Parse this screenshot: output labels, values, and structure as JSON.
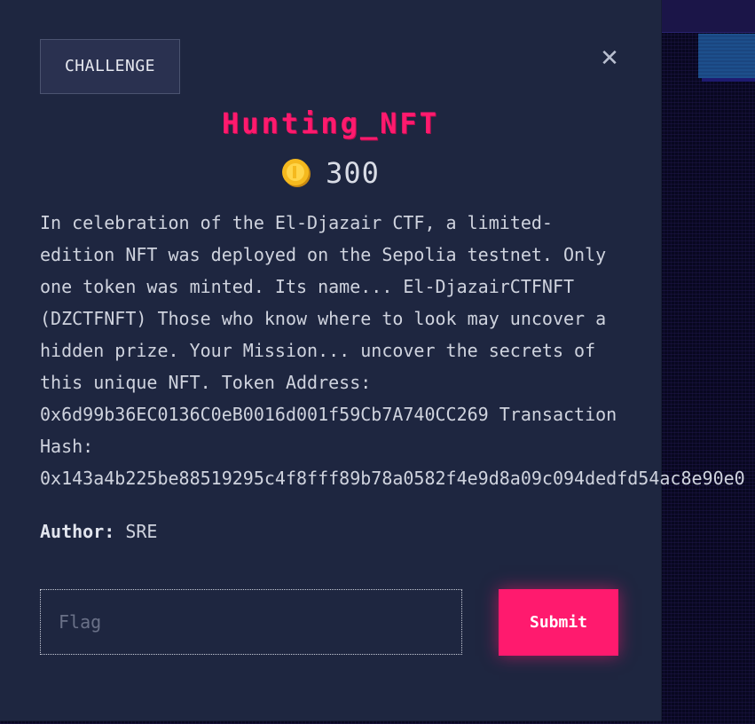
{
  "modal": {
    "badge_label": "CHALLENGE",
    "close_icon": "close-icon",
    "title": "Hunting_NFT",
    "points": "300",
    "coin_icon": "coin-icon",
    "description": "In celebration of the El-Djazair CTF, a limited-\nedition NFT was deployed on the Sepolia testnet. Only\none token was minted. Its name... El-DjazairCTFNFT\n(DZCTFNFT) Those who know where to look may uncover a\nhidden prize. Your Mission... uncover the secrets of\nthis unique NFT. Token Address:\n0x6d99b36EC0136C0eB0016d001f59Cb7A740CC269 Transaction\nHash:\n0x143a4b225be88519295c4f8fff89b78a0582f4e9d8a09c094dedfd54ac8e90e0",
    "author_label": "Author:",
    "author_name": "SRE",
    "flag_placeholder": "Flag",
    "flag_value": "",
    "submit_label": "Submit"
  },
  "colors": {
    "accent": "#ff1a6e",
    "modal_bg": "#1e2640",
    "text": "#cfd3de"
  }
}
